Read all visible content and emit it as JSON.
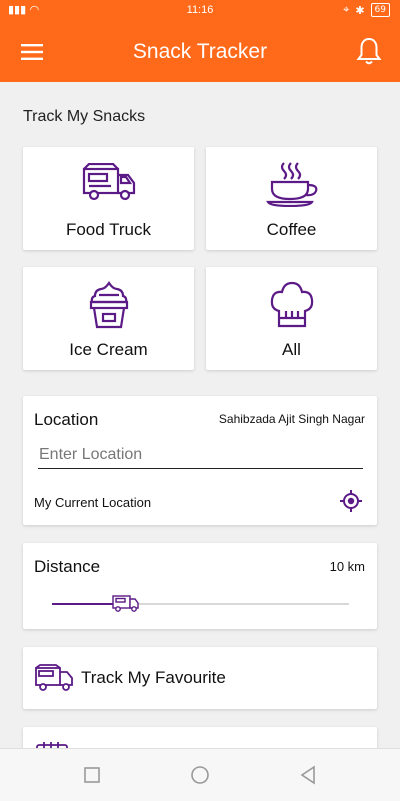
{
  "status_bar": {
    "time": "11:16",
    "battery": "69"
  },
  "app_bar": {
    "title": "Snack Tracker"
  },
  "section_title": "Track My Snacks",
  "categories": [
    {
      "label": "Food Truck",
      "icon": "food-truck-icon"
    },
    {
      "label": "Coffee",
      "icon": "coffee-cup-icon"
    },
    {
      "label": "Ice Cream",
      "icon": "ice-cream-icon"
    },
    {
      "label": "All",
      "icon": "chef-hat-icon"
    }
  ],
  "location": {
    "label": "Location",
    "value": "Sahibzada Ajit Singh Nagar",
    "input_placeholder": "Enter Location",
    "current_label": "My Current Location"
  },
  "distance": {
    "label": "Distance",
    "value": "10 km",
    "slider_fraction": 0.25
  },
  "favourite": {
    "label": "Track My Favourite"
  },
  "colors": {
    "primary": "#ff6a1a",
    "accent": "#5b1a86"
  }
}
